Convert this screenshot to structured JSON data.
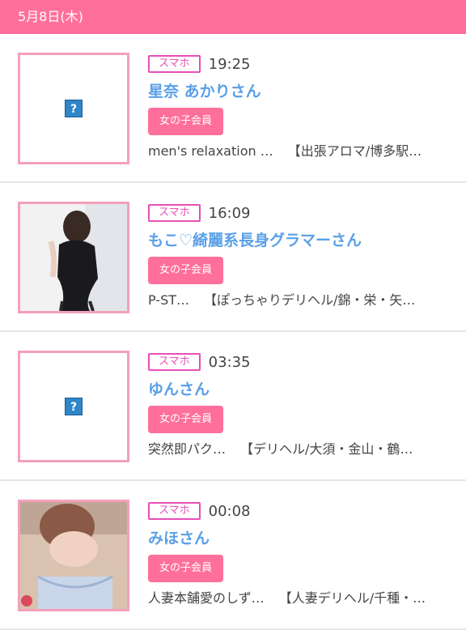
{
  "header": {
    "date": "5月8日(木)"
  },
  "items": [
    {
      "device": "スマホ",
      "time": "19:25",
      "name": "星奈 あかりさん",
      "member": "女の子会員",
      "shop": "men's relaxation …",
      "category": "【出張アロマ/博多駅…",
      "image": "broken-image-icon"
    },
    {
      "device": "スマホ",
      "time": "16:09",
      "name": "もこ♡綺麗系長身グラマーさん",
      "member": "女の子会員",
      "shop": "P-ST…",
      "category": "【ぽっちゃりデリヘル/錦・栄・矢…",
      "image": "profile-photo"
    },
    {
      "device": "スマホ",
      "time": "03:35",
      "name": "ゆんさん",
      "member": "女の子会員",
      "shop": "突然即パク…",
      "category": "【デリヘル/大須・金山・鶴…",
      "image": "broken-image-icon"
    },
    {
      "device": "スマホ",
      "time": "00:08",
      "name": "みほさん",
      "member": "女の子会員",
      "shop": "人妻本舗愛のしず…",
      "category": "【人妻デリヘル/千種・…",
      "image": "profile-photo"
    }
  ],
  "colors": {
    "accent_pink": "#ff6f9c",
    "device_badge": "#e84fb8",
    "name_blue": "#5aa0e8"
  }
}
